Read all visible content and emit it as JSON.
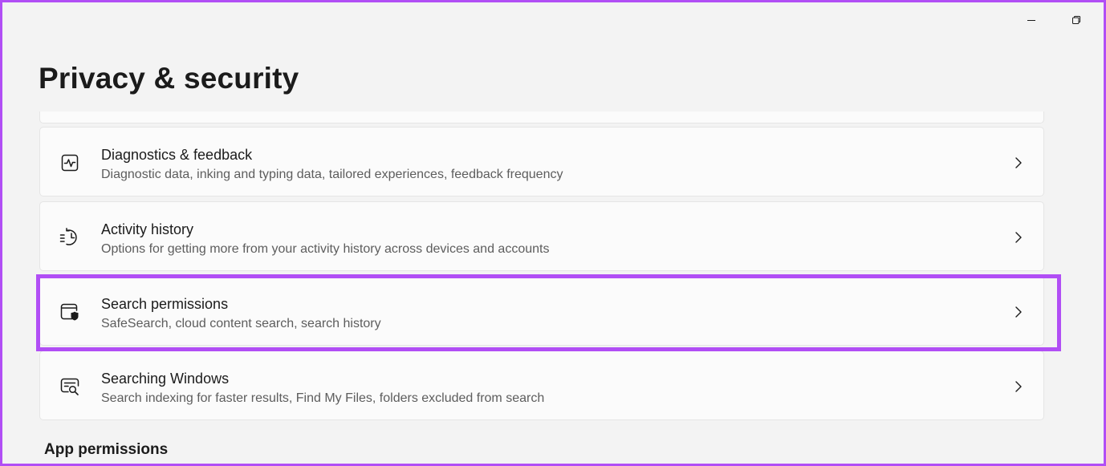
{
  "window": {
    "controls": [
      {
        "name": "minimize-icon",
        "glyph": "minimize"
      },
      {
        "name": "restore-icon",
        "glyph": "restore"
      }
    ]
  },
  "header": {
    "title": "Privacy & security"
  },
  "settings_list": [
    {
      "id": "diagnostics",
      "icon": "diagnostics-icon",
      "title": "Diagnostics & feedback",
      "subtitle": "Diagnostic data, inking and typing data, tailored experiences, feedback frequency"
    },
    {
      "id": "activity-history",
      "icon": "activity-history-icon",
      "title": "Activity history",
      "subtitle": "Options for getting more from your activity history across devices and accounts"
    },
    {
      "id": "search-permissions",
      "icon": "search-permissions-icon",
      "title": "Search permissions",
      "subtitle": "SafeSearch, cloud content search, search history",
      "highlighted": true
    },
    {
      "id": "searching-windows",
      "icon": "searching-windows-icon",
      "title": "Searching Windows",
      "subtitle": "Search indexing for faster results, Find My Files, folders excluded from search"
    }
  ],
  "sections": {
    "app_permissions": "App permissions"
  },
  "colors": {
    "highlight": "#b14ef5",
    "background": "#f3f3f3",
    "card": "#fbfbfb",
    "text_primary": "#1b1b1b",
    "text_secondary": "#5d5d5d"
  }
}
